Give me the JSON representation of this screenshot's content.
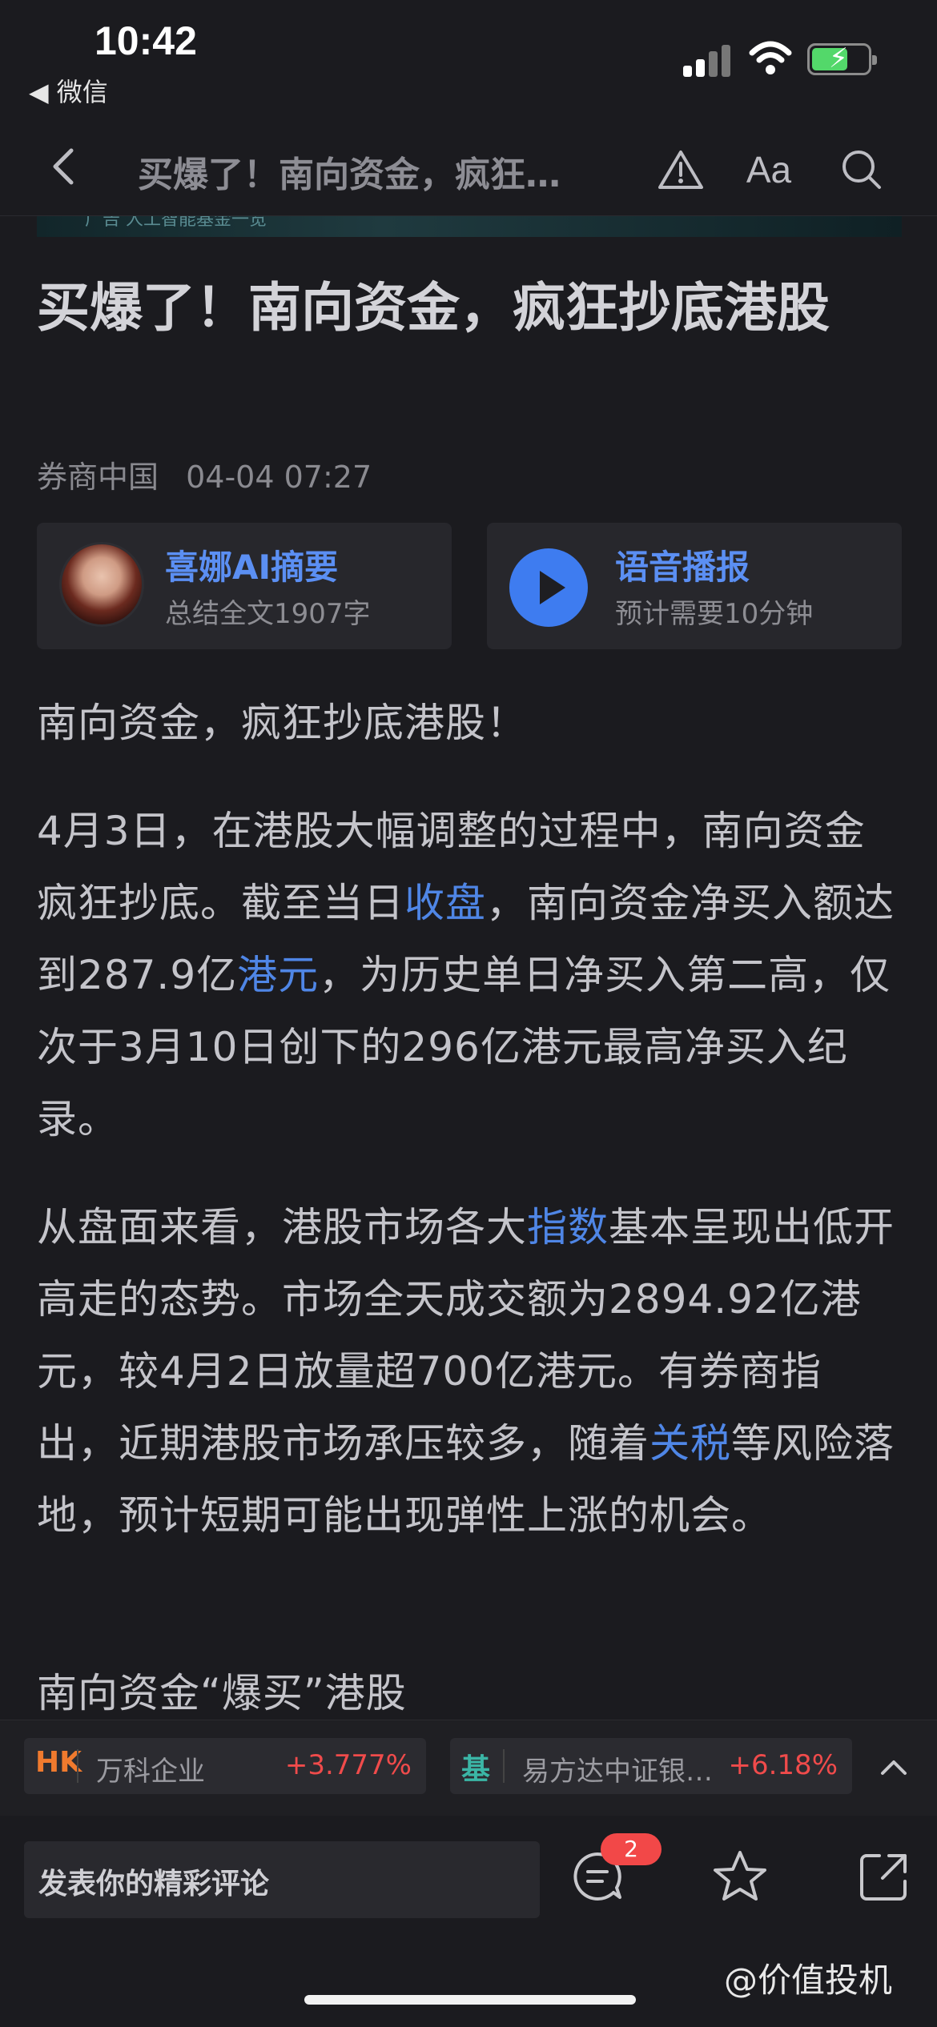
{
  "status_bar": {
    "time": "10:42",
    "back_app": "◀ 微信"
  },
  "nav": {
    "title": "买爆了！南向资金，疯狂…"
  },
  "banner": {
    "text": "广告  人工智能基金一览"
  },
  "article": {
    "headline": "买爆了！南向资金，疯狂抄底港股",
    "source": "券商中国",
    "date": "04-04 07:27",
    "ai_summary": {
      "title": "喜娜AI摘要",
      "subtitle": "总结全文1907字"
    },
    "audio": {
      "title": "语音播报",
      "subtitle": "预计需要10分钟"
    },
    "p1": "南向资金，疯狂抄底港股！",
    "p2": {
      "a": "4月3日，在港股大幅调整的过程中，南向资金疯狂抄底。截至当日",
      "link1": "收盘",
      "b": "，南向资金净买入额达到287.9亿",
      "link2": "港元",
      "c": "，为历史单日净买入第二高，仅次于3月10日创下的296亿港元最高净买入纪录。"
    },
    "p3": {
      "a": "从盘面来看，港股市场各大",
      "link1": "指数",
      "b": "基本呈现出低开高走的态势。市场全天成交额为2894.92亿港元，较4月2日放量超700亿港元。有券商指出，近期港股市场承压较多，随着",
      "link2": "关税",
      "c": "等风险落地，预计短期可能出现弹性上涨的机会。"
    },
    "p4": "南向资金“爆买”港股"
  },
  "funds": [
    {
      "tag": "HK",
      "tag_color": "#f07a2e",
      "name": "万科企业",
      "change": "+3.777%"
    },
    {
      "tag": "基",
      "tag_color": "#3bb6a6",
      "name": "易方达中证银…",
      "change": "+6.18%"
    }
  ],
  "bottom": {
    "comment_placeholder": "发表你的精彩评论",
    "comment_count": "2"
  },
  "watermark": "@价值投机"
}
